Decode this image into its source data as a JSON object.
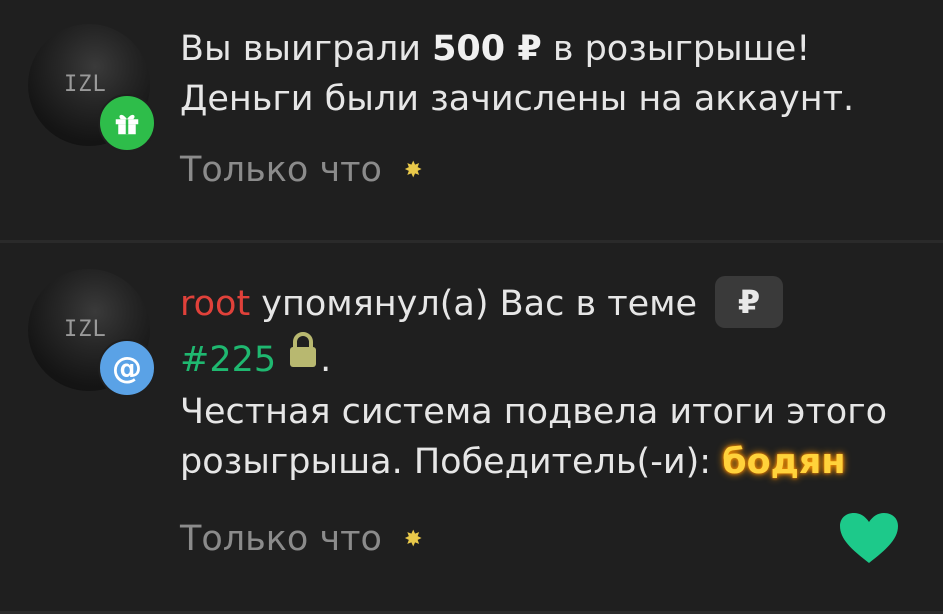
{
  "notifications": [
    {
      "line1_pre": "Вы выиграли ",
      "amount": "500 ₽",
      "line1_post": " в розыгрыше!",
      "line2": "Деньги были зачислены на аккаунт.",
      "time": "Только что"
    },
    {
      "username": "root",
      "action": " упомянул(а) Вас в теме",
      "topic_chip": "₽",
      "topic": "#225",
      "after_topic": ".",
      "body": "Честная система подвела итоги этого розыгрыша. Победитель(-и): ",
      "winner": "бодян",
      "time": "Только что"
    }
  ],
  "colors": {
    "background": "#1f1f1f",
    "username": "#e0413a",
    "topic": "#1fb870",
    "winner": "#ffd23b",
    "heart": "#1dc98a",
    "gift_badge": "#2ebd4a",
    "mention_badge": "#5aa2e6"
  },
  "icons": [
    "gift-icon",
    "at-sign-icon",
    "lock-icon",
    "heart-icon",
    "sparkle-icon"
  ]
}
